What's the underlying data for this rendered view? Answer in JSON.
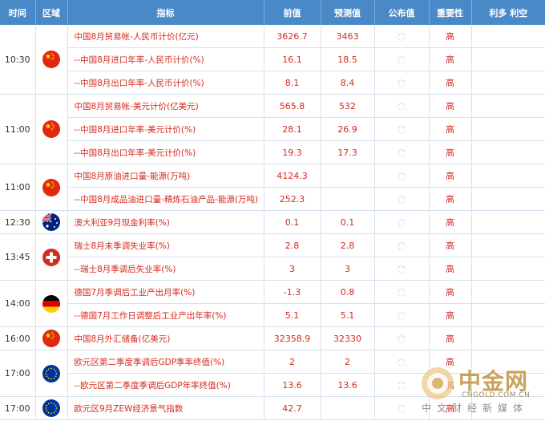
{
  "header": {
    "time": "时间",
    "region": "区域",
    "indicator": "指标",
    "previous": "前值",
    "forecast": "预测值",
    "actual": "公布值",
    "importance": "重要性",
    "impact": "利多 利空"
  },
  "groups": [
    {
      "time": "10:30",
      "flag": "china-flag-icon",
      "rows": [
        {
          "indicator": "中国8月贸易帐-人民币计价(亿元)",
          "previous": "3626.7",
          "forecast": "3463",
          "importance": "高"
        },
        {
          "indicator": "--中国8月进口年率-人民币计价(%)",
          "previous": "16.1",
          "forecast": "18.5",
          "importance": "高"
        },
        {
          "indicator": "--中国8月出口年率-人民币计价(%)",
          "previous": "8.1",
          "forecast": "8.4",
          "importance": "高"
        }
      ]
    },
    {
      "time": "11:00",
      "flag": "china-flag-icon",
      "rows": [
        {
          "indicator": "中国8月贸易帐-美元计价(亿美元)",
          "previous": "565.8",
          "forecast": "532",
          "importance": "高"
        },
        {
          "indicator": "--中国8月进口年率-美元计价(%)",
          "previous": "28.1",
          "forecast": "26.9",
          "importance": "高"
        },
        {
          "indicator": "--中国8月出口年率-美元计价(%)",
          "previous": "19.3",
          "forecast": "17.3",
          "importance": "高"
        }
      ]
    },
    {
      "time": "11:00",
      "flag": "china-flag-icon",
      "rows": [
        {
          "indicator": "中国8月原油进口量-能源(万吨)",
          "previous": "4124.3",
          "forecast": "",
          "importance": "高"
        },
        {
          "indicator": "--中国8月成品油进口量-精炼石油产品-能源(万吨)",
          "previous": "252.3",
          "forecast": "",
          "importance": "高"
        }
      ]
    },
    {
      "time": "12:30",
      "flag": "australia-flag-icon",
      "rows": [
        {
          "indicator": "澳大利亚9月现金利率(%)",
          "previous": "0.1",
          "forecast": "0.1",
          "importance": "高"
        }
      ]
    },
    {
      "time": "13:45",
      "flag": "switzerland-flag-icon",
      "rows": [
        {
          "indicator": "瑞士8月未季调失业率(%)",
          "previous": "2.8",
          "forecast": "2.8",
          "importance": "高"
        },
        {
          "indicator": "--瑞士8月季调后失业率(%)",
          "previous": "3",
          "forecast": "3",
          "importance": "高"
        }
      ]
    },
    {
      "time": "14:00",
      "flag": "germany-flag-icon",
      "rows": [
        {
          "indicator": "德国7月季调后工业产出月率(%)",
          "previous": "-1.3",
          "forecast": "0.8",
          "importance": "高"
        },
        {
          "indicator": "--德国7月工作日调整后工业产出年率(%)",
          "previous": "5.1",
          "forecast": "5.1",
          "importance": "高"
        }
      ]
    },
    {
      "time": "16:00",
      "flag": "china-flag-icon",
      "rows": [
        {
          "indicator": "中国8月外汇储备(亿美元)",
          "previous": "32358.9",
          "forecast": "32330",
          "importance": "高"
        }
      ]
    },
    {
      "time": "17:00",
      "flag": "eu-flag-icon",
      "rows": [
        {
          "indicator": "欧元区第二季度季调后GDP季率终值(%)",
          "previous": "2",
          "forecast": "2",
          "importance": "高"
        },
        {
          "indicator": "--欧元区第二季度季调后GDP年率终值(%)",
          "previous": "13.6",
          "forecast": "13.6",
          "importance": "高"
        }
      ]
    },
    {
      "time": "17:00",
      "flag": "eu-flag-icon",
      "rows": [
        {
          "indicator": "欧元区9月ZEW经济景气指数",
          "previous": "42.7",
          "forecast": "",
          "importance": "高"
        }
      ]
    }
  ],
  "watermark": {
    "name": "中金网",
    "url": "CNGOLD.COM.CN",
    "tagline": "中文财经新媒体"
  },
  "colors": {
    "header_bg": "#4a89c8",
    "value_red": "#d62a1d",
    "border": "#d5e1ee",
    "watermark_gold": "#c9a25a"
  }
}
